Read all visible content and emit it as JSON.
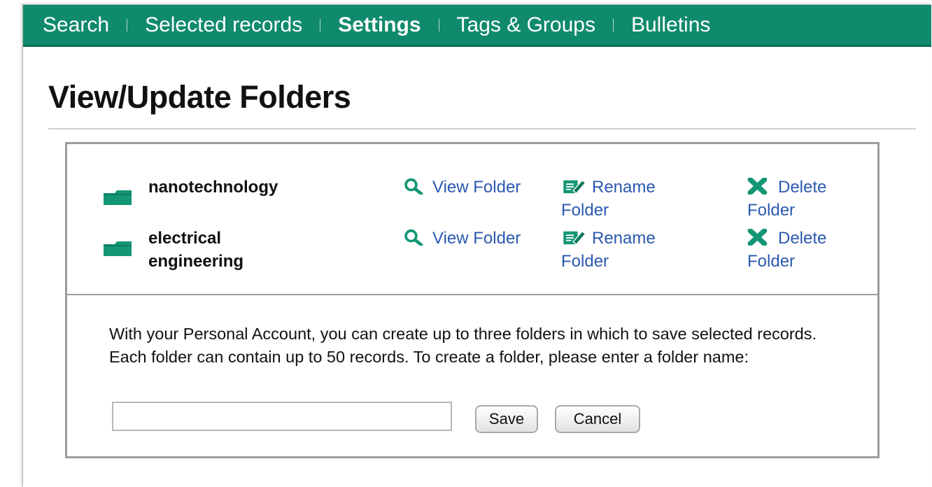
{
  "nav": {
    "items": [
      {
        "label": "Search",
        "active": false
      },
      {
        "label": "Selected records",
        "active": false
      },
      {
        "label": "Settings",
        "active": true
      },
      {
        "label": "Tags & Groups",
        "active": false
      },
      {
        "label": "Bulletins",
        "active": false
      }
    ]
  },
  "page": {
    "title": "View/Update Folders"
  },
  "folders": [
    {
      "name": "nanotechnology",
      "view_label": "View Folder",
      "rename_label": "Rename Folder",
      "delete_label": "Delete Folder"
    },
    {
      "name": "electrical engineering",
      "view_label": "View Folder",
      "rename_label": "Rename Folder",
      "delete_label": "Delete Folder"
    }
  ],
  "info": {
    "line1": "With your Personal Account, you can create up to three folders in which to save selected records.",
    "line2": "Each folder can contain up to 50 records. To create a folder, please enter a folder name:"
  },
  "form": {
    "folder_name_value": "",
    "save_label": "Save",
    "cancel_label": "Cancel"
  },
  "icons": {
    "folder": "folder-icon",
    "view": "magnifier-icon",
    "rename": "edit-icon",
    "delete": "x-icon"
  },
  "colors": {
    "navbar": "#0f8a6c",
    "link": "#2b58b0",
    "icon_green": "#139673"
  }
}
